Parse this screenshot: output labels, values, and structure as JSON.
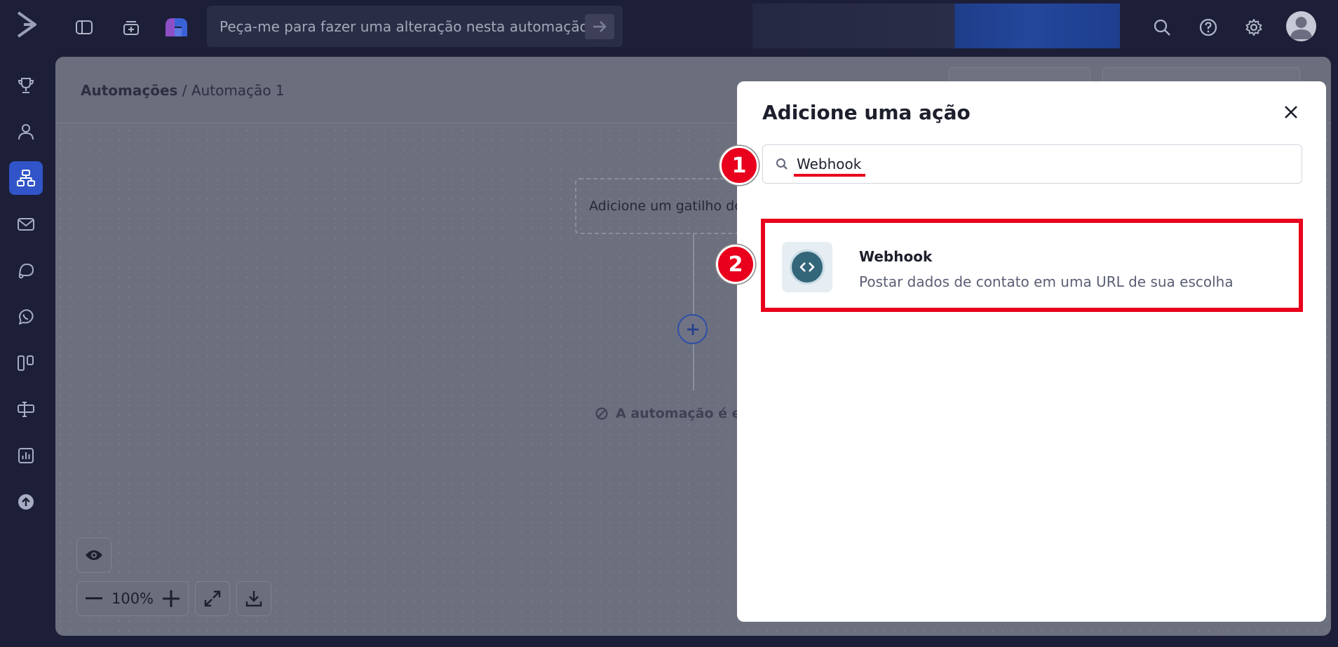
{
  "topbar": {
    "ai_prompt_placeholder": "Peça-me para fazer uma alteração nesta automação"
  },
  "breadcrumb": {
    "root": "Automações",
    "separator": "/",
    "current": "Automação 1"
  },
  "canvas": {
    "trigger_placeholder": "Adicione um gatilho de",
    "warning_text": "A automação é en",
    "zoom_level": "100%"
  },
  "modal": {
    "title": "Adicione uma ação",
    "search_value": "Webhook",
    "results": [
      {
        "title": "Webhook",
        "description": "Postar dados de contato em uma URL de sua escolha",
        "icon": "code-brackets-icon"
      }
    ]
  },
  "annotations": {
    "step1": "1",
    "step2": "2"
  },
  "colors": {
    "nav_background": "#1c1f37",
    "active_nav": "#3155c9",
    "highlight_red": "#e8001c",
    "webhook_icon": "#34667a"
  },
  "icons": {
    "topbar": [
      "logo-icon",
      "sidebar-toggle-icon",
      "inbox-add-icon",
      "app-logo-icon",
      "arrow-right-icon",
      "search-icon",
      "help-icon",
      "settings-icon",
      "avatar"
    ],
    "sidenav": [
      "trophy-icon",
      "contacts-icon",
      "automations-icon",
      "email-icon",
      "conversations-icon",
      "whatsapp-icon",
      "pipelines-icon",
      "forms-icon",
      "reports-icon",
      "upgrade-icon"
    ]
  }
}
